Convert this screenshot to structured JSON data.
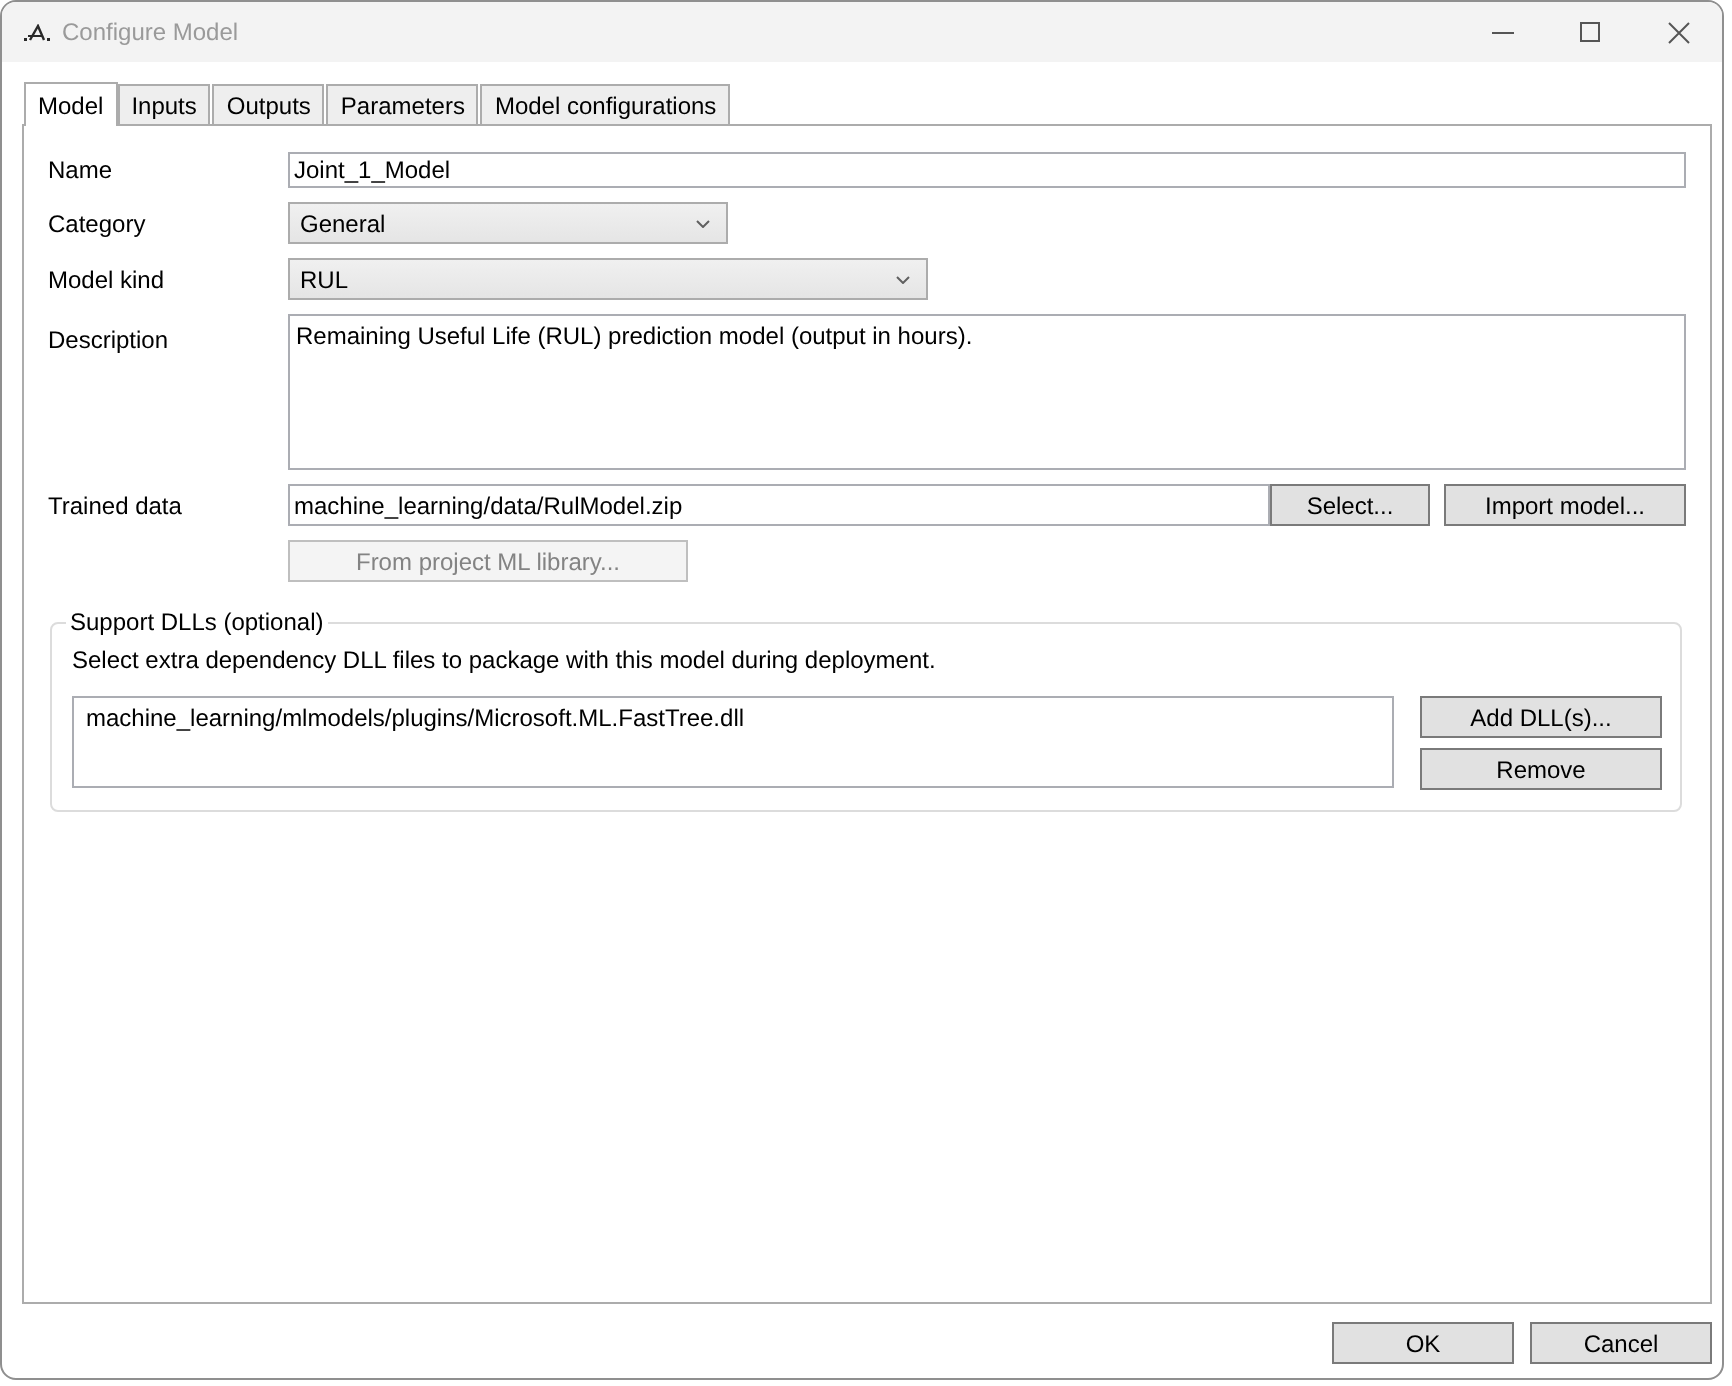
{
  "window": {
    "title": "Configure Model"
  },
  "tabs": [
    {
      "label": "Model",
      "selected": true
    },
    {
      "label": "Inputs",
      "selected": false
    },
    {
      "label": "Outputs",
      "selected": false
    },
    {
      "label": "Parameters",
      "selected": false
    },
    {
      "label": "Model configurations",
      "selected": false
    }
  ],
  "form": {
    "fields": [
      {
        "kind": "text",
        "label": "Name",
        "value": "Joint_1_Model"
      },
      {
        "kind": "combo",
        "label": "Category",
        "value": "General"
      },
      {
        "kind": "combo",
        "label": "Model kind",
        "value": "RUL"
      },
      {
        "kind": "textarea",
        "label": "Description",
        "value": "Remaining Useful Life (RUL) prediction model (output in hours)."
      },
      {
        "kind": "file",
        "label": "Trained data",
        "value": "machine_learning/data/RulModel.zip",
        "buttons": [
          "Select...",
          "Import model..."
        ]
      }
    ],
    "library_button": {
      "label": "From project ML library...",
      "disabled": true
    }
  },
  "support_dlls": {
    "title": "Support DLLs (optional)",
    "hint": "Select extra dependency DLL files to package with this model during deployment.",
    "files": [
      {
        "path": "machine_learning/mlmodels/plugins/Microsoft.ML.FastTree.dll",
        "selected": false
      }
    ],
    "buttons": [
      "Add DLL(s)...",
      "Remove"
    ]
  },
  "footer_buttons": [
    "OK",
    "Cancel"
  ]
}
